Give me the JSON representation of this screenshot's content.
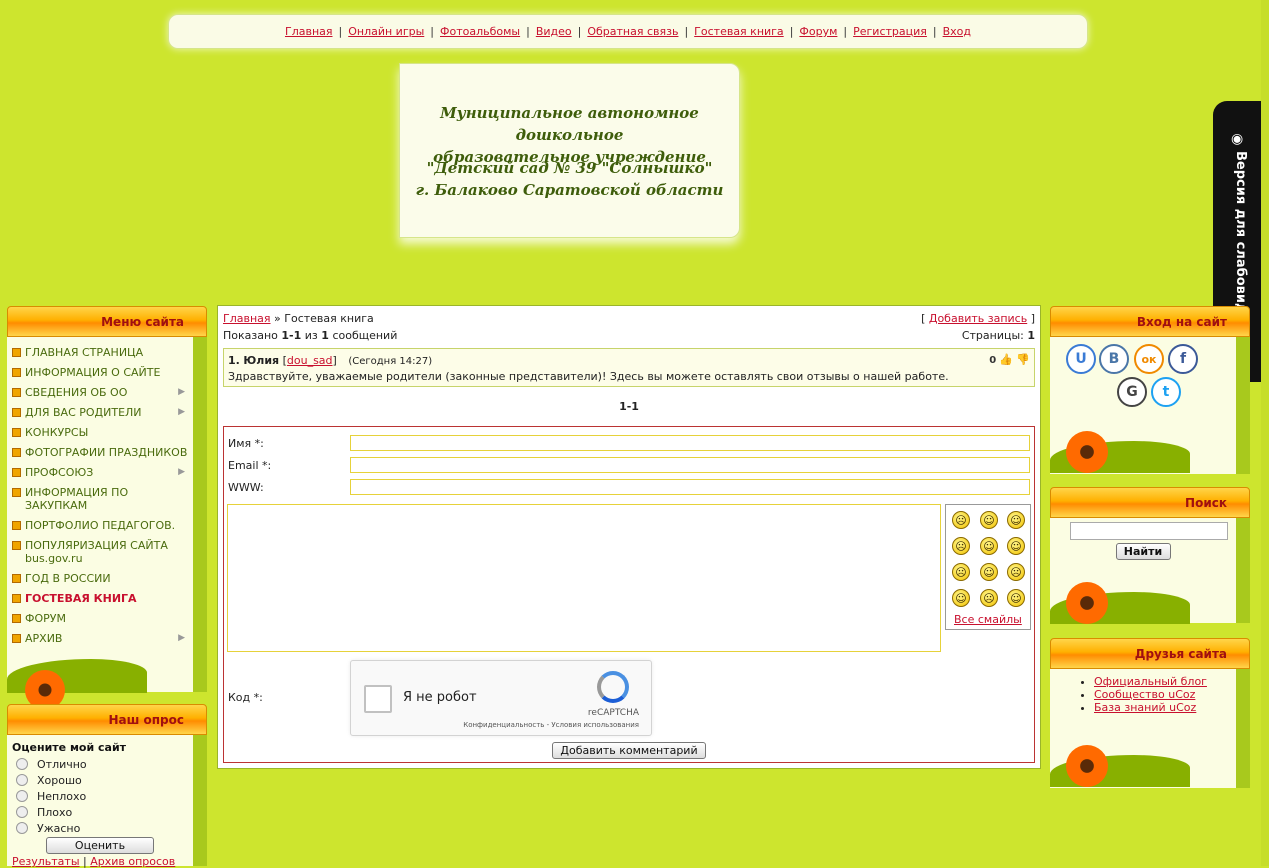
{
  "nav": {
    "links": [
      "Главная",
      "Онлайн игры",
      "Фотоальбомы",
      "Видео",
      "Обратная связь",
      "Гостевая книга",
      "Форум",
      "Регистрация",
      "Вход"
    ]
  },
  "header": {
    "line1": "Муниципальное автономное дошкольное",
    "line2": "образовательное учреждение",
    "line3": "\"Детский сад № 39 \"Солнышко\"",
    "line4": "г. Балаково Саратовской области"
  },
  "vision_tab": {
    "label": "Версия для слабовидящих",
    "icon": "eye-icon"
  },
  "menu": {
    "title": "Меню сайта",
    "items": [
      {
        "label": "ГЛАВНАЯ СТРАНИЦА",
        "sub": false
      },
      {
        "label": "ИНФОРМАЦИЯ О САЙТЕ",
        "sub": false
      },
      {
        "label": "СВЕДЕНИЯ ОБ ОО",
        "sub": true
      },
      {
        "label": "ДЛЯ ВАС РОДИТЕЛИ",
        "sub": true
      },
      {
        "label": "КОНКУРСЫ",
        "sub": false
      },
      {
        "label": "ФОТОГРАФИИ ПРАЗДНИКОВ",
        "sub": false
      },
      {
        "label": "ПРОФСОЮЗ",
        "sub": true
      },
      {
        "label": "ИНФОРМАЦИЯ ПО ЗАКУПКАМ",
        "sub": false
      },
      {
        "label": "ПОРТФОЛИО ПЕДАГОГОВ.",
        "sub": false
      },
      {
        "label": "ПОПУЛЯРИЗАЦИЯ САЙТА bus.gov.ru",
        "sub": false
      },
      {
        "label": "ГОД В РОССИИ",
        "sub": false
      },
      {
        "label": "ГОСТЕВАЯ КНИГА",
        "sub": false,
        "active": true
      },
      {
        "label": "ФОРУМ",
        "sub": false
      },
      {
        "label": "АРХИВ",
        "sub": true
      }
    ]
  },
  "poll": {
    "title": "Наш опрос",
    "question": "Оцените мой сайт",
    "options": [
      "Отлично",
      "Хорошо",
      "Неплохо",
      "Плохо",
      "Ужасно"
    ],
    "button": "Оценить",
    "results_link": "Результаты",
    "archive_link": "Архив опросов"
  },
  "main": {
    "crumb_home": "Главная",
    "crumb_sep": "»",
    "crumb_current": "Гостевая книга",
    "add_prefix": "[",
    "add_link": "Добавить запись",
    "add_suffix": "]",
    "shown_prefix": "Показано",
    "shown_range": "1-1",
    "shown_of": "из",
    "shown_total": "1",
    "shown_suffix": "сообщений",
    "pages_label": "Страницы:",
    "pages_value": "1",
    "entry": {
      "number": "1.",
      "author": "Юлия",
      "login": "dou_sad",
      "time": "(Сегодня 14:27)",
      "rating": "0",
      "text": "Здравствуйте, уважаемые родители (законные представители)! Здесь вы можете оставлять свои отзывы о нашей работе."
    },
    "pager": "1-1",
    "form": {
      "name_label": "Имя *:",
      "email_label": "Email *:",
      "www_label": "WWW:",
      "all_smiles": "Все смайлы",
      "code_label": "Код *:",
      "captcha_label": "Я не робот",
      "captcha_brand": "reCAPTCHA",
      "captcha_terms": "Конфиденциальность - Условия использования",
      "submit": "Добавить комментарий"
    }
  },
  "login": {
    "title": "Вход на сайт",
    "socials": [
      "U",
      "B",
      "ок",
      "f",
      "G",
      "t"
    ]
  },
  "search": {
    "title": "Поиск",
    "button": "Найти"
  },
  "friends": {
    "title": "Друзья сайта",
    "links": [
      "Официальный блог",
      "Сообщество uCoz",
      "База знаний uCoz"
    ]
  }
}
